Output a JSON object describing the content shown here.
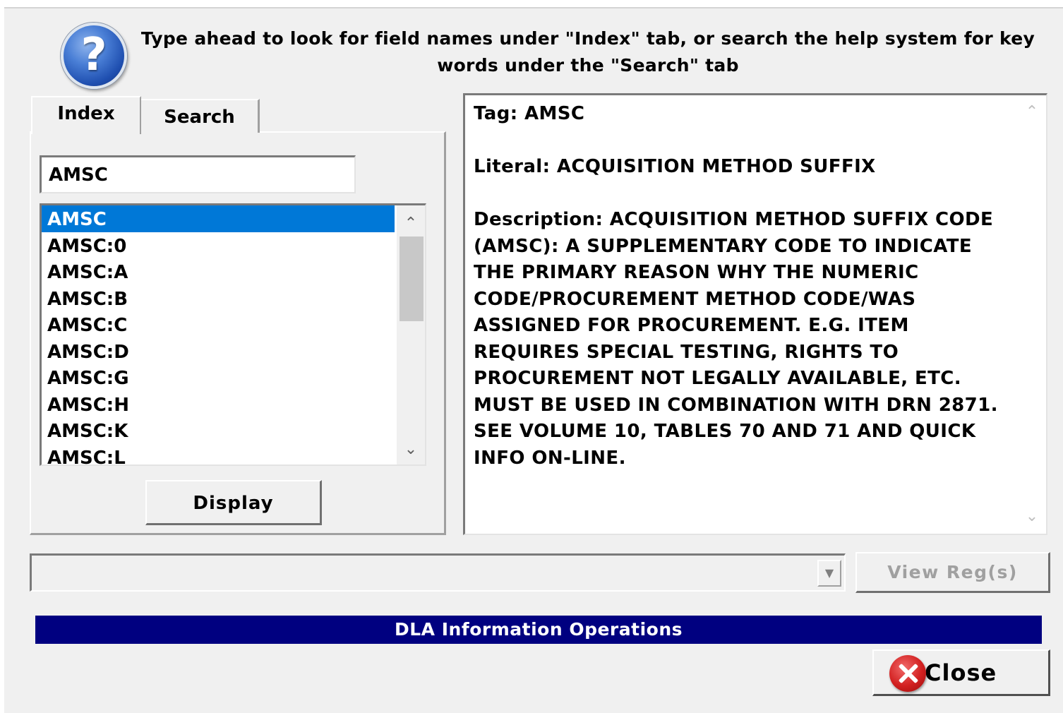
{
  "header": {
    "icon": "help-icon",
    "instructions": "Type ahead to look for field names under \"Index\" tab, or search the help system for key words under the \"Search\" tab"
  },
  "tabs": [
    {
      "label": "Index",
      "active": true
    },
    {
      "label": "Search",
      "active": false
    }
  ],
  "index": {
    "search_value": "AMSC",
    "items": [
      "AMSC",
      "AMSC:0",
      "AMSC:A",
      "AMSC:B",
      "AMSC:C",
      "AMSC:D",
      "AMSC:G",
      "AMSC:H",
      "AMSC:K",
      "AMSC:L"
    ],
    "selected_item": "AMSC",
    "display_label": "Display"
  },
  "detail": {
    "tag": "Tag:  AMSC",
    "literal": "Literal:  ACQUISITION METHOD SUFFIX",
    "description": "Description:  ACQUISITION METHOD SUFFIX CODE (AMSC): A SUPPLEMENTARY CODE TO INDICATE THE PRIMARY REASON WHY THE NUMERIC CODE/PROCUREMENT METHOD CODE/WAS ASSIGNED FOR PROCUREMENT. E.G. ITEM REQUIRES SPECIAL TESTING, RIGHTS TO PROCUREMENT NOT LEGALLY AVAILABLE, ETC. MUST BE USED IN COMBINATION WITH DRN 2871. SEE VOLUME 10, TABLES 70 AND 71 AND QUICK INFO ON-LINE."
  },
  "regs": {
    "selected_value": "",
    "view_label": "View Reg(s)"
  },
  "footer": {
    "banner": "DLA Information Operations",
    "close_label": "Close"
  },
  "colors": {
    "banner_bg": "#000080",
    "selection": "#0078d7",
    "close_icon": "#d22020"
  }
}
